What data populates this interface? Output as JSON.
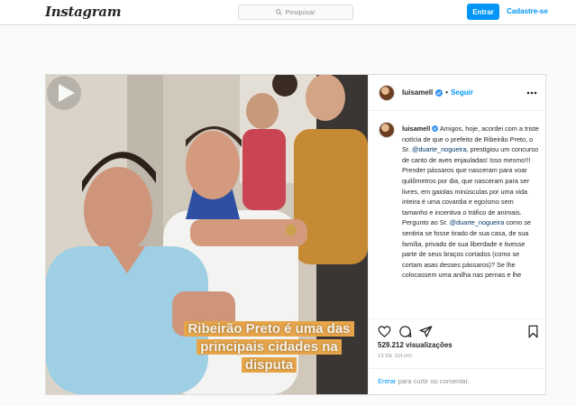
{
  "header": {
    "logo": "Instagram",
    "search_placeholder": "Pesquisar",
    "login_label": "Entrar",
    "signup_label": "Cadastre-se"
  },
  "post": {
    "username": "luisamell",
    "follow_label": "Seguir",
    "separator": "•",
    "video_caption_lines": [
      "Ribeirão Preto é uma das",
      "principais cidades na",
      "disputa"
    ],
    "caption": {
      "p1_text_before": "Amigos, hoje, acordei com a triste notícia de que o prefeito de Ribeirão Preto, o Sr.",
      "p1_mention": "@duarte_nogueira",
      "p1_text_after": ", prestigiou um concurso de canto de aves enjauladas! Isso mesmo!!! Prender pássaros que nasceram para voar quilômetros por dia, que nasceram para ser livres, em gaiolas minúsculas por uma vida inteira é uma covardia e egoísmo sem tamanho e incentiva o tráfico de animais.",
      "p2_text_before": "Pergunto ao Sr.",
      "p2_mention": "@duarte_nogueira",
      "p2_text_after": "como se sentiria se fosse tirado de sua casa, de sua família, privado de sua liberdade e tivesse parte de seus braços cortados (como se cortam asas desses pássaros)? Se lhe colocassem uma anilha nas pernas e lhe"
    },
    "views_count": "529.212",
    "views_label": "visualizações",
    "date": "13 DE JULHO",
    "login_prompt_link": "Entrar",
    "login_prompt_text": "para curtir ou comentar."
  },
  "colors": {
    "accent": "#0095f6",
    "border": "#dbdbdb",
    "overlay_highlight": "#e8a64a"
  }
}
